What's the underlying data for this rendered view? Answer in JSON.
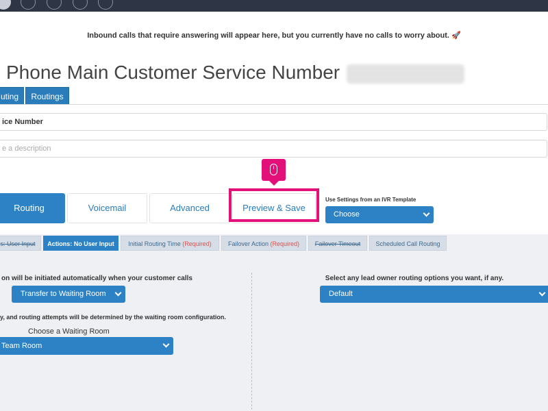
{
  "notice": {
    "text": "Inbound calls that require answering will appear here, but you currently have no calls to worry about. 🚀"
  },
  "header": {
    "title": "Phone Main Customer Service Number"
  },
  "subtabs": [
    "uting",
    "Routings"
  ],
  "form": {
    "name_value": "ice Number",
    "description_placeholder": "e a description"
  },
  "main_tabs": [
    "Routing",
    "Voicemail",
    "Advanced",
    "Preview & Save"
  ],
  "ivr_template": {
    "label": "Use Settings from an IVR Template",
    "selected": "Choose"
  },
  "steps": [
    {
      "label": "s: User Input",
      "required": ""
    },
    {
      "label": "Actions: No User Input",
      "required": ""
    },
    {
      "label": "Initial Routing Time",
      "required": "(Required)"
    },
    {
      "label": "Failover Action",
      "required": "(Required)"
    },
    {
      "label": "Failover Timeout",
      "required": ""
    },
    {
      "label": "Scheduled Call Routing",
      "required": ""
    }
  ],
  "left_panel": {
    "label": "on will be initiated automatically when your customer calls",
    "action_selected": "Transfer to Waiting Room",
    "note": "y, and routing attempts will be determined by the waiting room configuration.",
    "waiting_room_label": "Choose a Waiting Room",
    "waiting_room_selected": "Team Room"
  },
  "right_panel": {
    "label": "Select any lead owner routing options you want, if any.",
    "selected": "Default"
  },
  "colors": {
    "accent": "#2c82c4",
    "highlight": "#e4107a",
    "topbar": "#2e3545"
  },
  "icons": [
    "mouse-icon",
    "chevron-down-icon"
  ]
}
